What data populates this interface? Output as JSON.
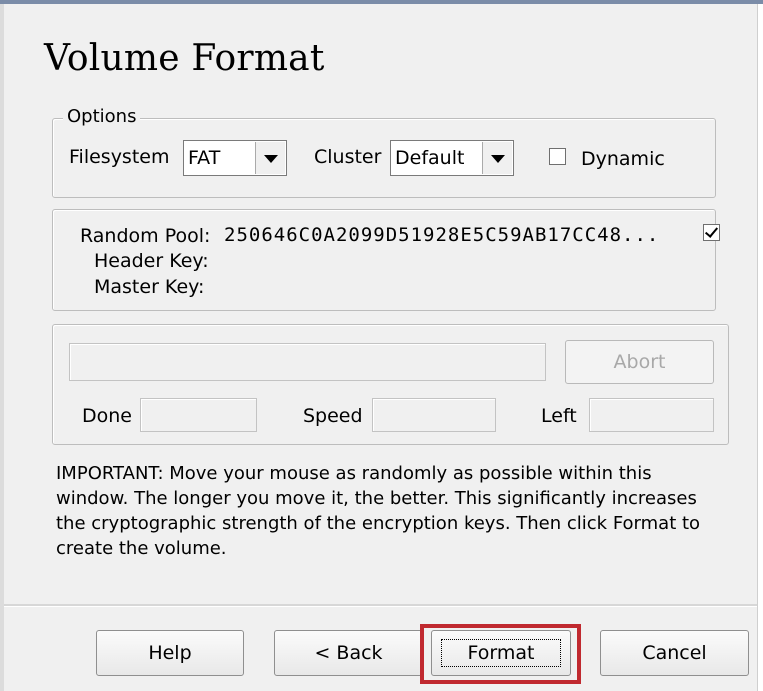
{
  "title": "Volume Format",
  "options": {
    "legend": "Options",
    "filesystem_label": "Filesystem",
    "filesystem_value": "FAT",
    "cluster_label": "Cluster",
    "cluster_value": "Default",
    "dynamic_label": "Dynamic",
    "dynamic_checked": false
  },
  "keys": {
    "random_pool_label": "Random Pool:",
    "random_pool_value": "250646C0A2099D51928E5C59AB17CC48...",
    "show_checked": true,
    "header_key_label": "Header Key:",
    "master_key_label": "Master Key:"
  },
  "progress": {
    "abort_label": "Abort",
    "done_label": "Done",
    "speed_label": "Speed",
    "left_label": "Left"
  },
  "important_text": "IMPORTANT: Move your mouse as randomly as possible within this window. The longer you move it, the better. This significantly increases the cryptographic strength of the encryption keys. Then click Format to create the volume.",
  "buttons": {
    "help": "Help",
    "back": "< Back",
    "format": "Format",
    "cancel": "Cancel"
  },
  "colors": {
    "highlight": "#c0292f",
    "background": "#f0f0f0"
  }
}
